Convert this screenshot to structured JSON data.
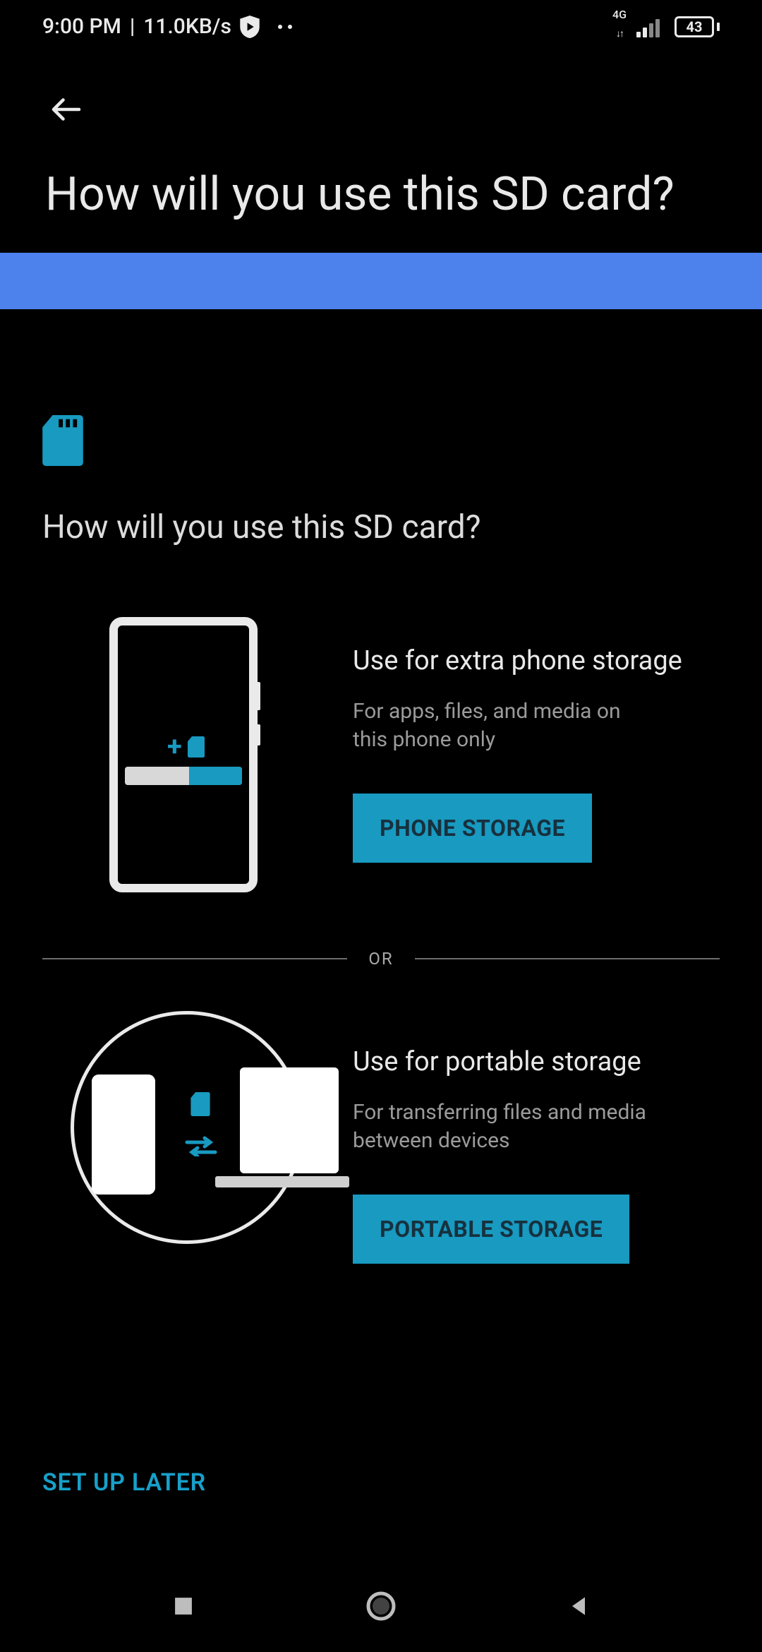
{
  "status": {
    "time": "9:00 PM",
    "net_speed": "11.0KB/s",
    "network_type": "4G",
    "battery_pct": "43"
  },
  "header": {
    "title": "How will you use this SD card?"
  },
  "content": {
    "subheading": "How will you use this SD card?",
    "options": [
      {
        "title": "Use for extra phone storage",
        "description": "For apps, files, and media on this phone only",
        "button": "PHONE STORAGE"
      },
      {
        "title": "Use for portable storage",
        "description": "For transferring files and media between devices",
        "button": "PORTABLE STORAGE"
      }
    ],
    "or_label": "OR"
  },
  "footer": {
    "setup_later_label": "SET UP LATER"
  },
  "colors": {
    "accent": "#189ac1",
    "band": "#4d82ec",
    "bg": "#000000",
    "text": "#e6e6e6",
    "muted": "#9b9b9b"
  }
}
